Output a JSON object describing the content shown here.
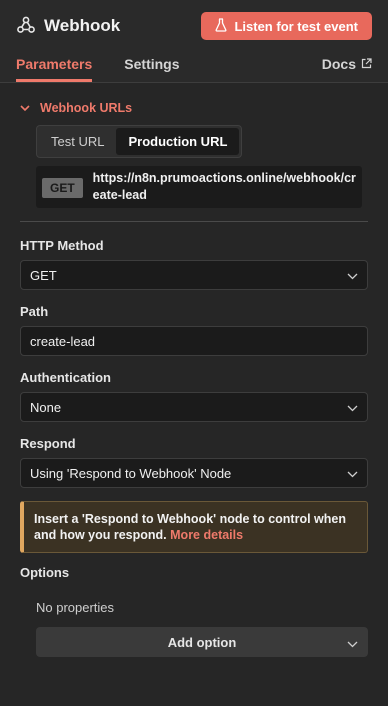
{
  "header": {
    "title": "Webhook",
    "listen_button": "Listen for test event"
  },
  "tabs": {
    "parameters": "Parameters",
    "settings": "Settings",
    "docs": "Docs"
  },
  "webhook_urls": {
    "title": "Webhook URLs",
    "url_tabs": [
      "Test URL",
      "Production URL"
    ],
    "selected_tab": "Production URL",
    "method": "GET",
    "url": "https://n8n.prumoactions.online/webhook/create-lead"
  },
  "fields": {
    "http_method": {
      "label": "HTTP Method",
      "value": "GET"
    },
    "path": {
      "label": "Path",
      "value": "create-lead"
    },
    "authentication": {
      "label": "Authentication",
      "value": "None"
    },
    "respond": {
      "label": "Respond",
      "value": "Using 'Respond to Webhook' Node"
    }
  },
  "notice": {
    "text": "Insert a 'Respond to Webhook' node to control when and how you respond.",
    "link": "More details"
  },
  "options": {
    "label": "Options",
    "empty": "No properties",
    "add_button": "Add option"
  },
  "colors": {
    "accent": "#ef7a6b",
    "button": "#e8695c",
    "warning": "#e0a75f"
  }
}
